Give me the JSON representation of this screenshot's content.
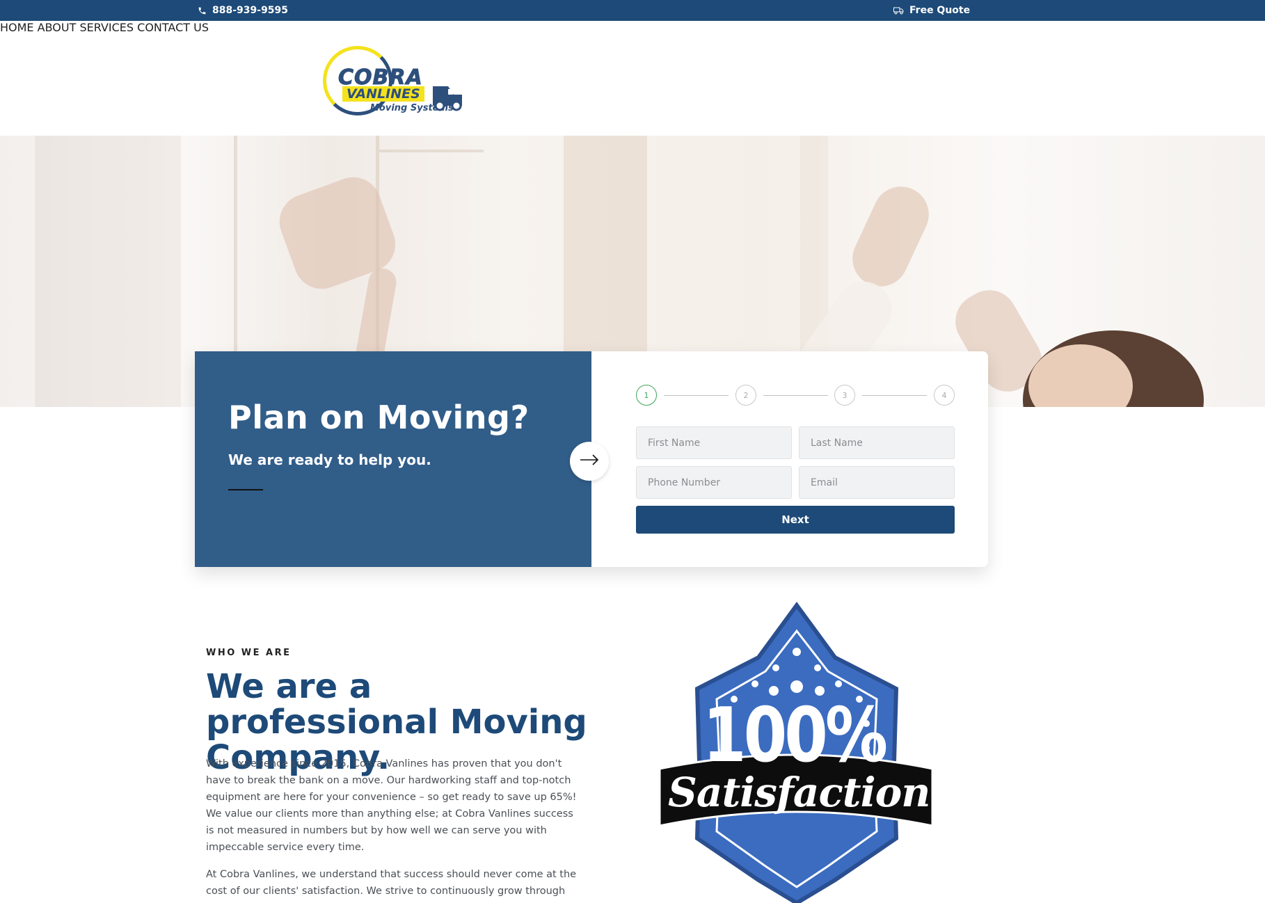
{
  "topbar": {
    "phone": "888-939-9595",
    "quote_label": "Free Quote"
  },
  "logo": {
    "line1": "COBRA",
    "line2": "VANLINES",
    "line3": "Moving Systems"
  },
  "nav": {
    "items": [
      "HOME",
      "ABOUT",
      "SERVICES",
      "CONTACT US"
    ]
  },
  "hero_card": {
    "title": "Plan on Moving?",
    "subtitle": "We are ready to help you.",
    "steps": [
      "1",
      "2",
      "3",
      "4"
    ],
    "active_step": 1,
    "fields": {
      "first_name_placeholder": "First Name",
      "last_name_placeholder": "Last Name",
      "phone_placeholder": "Phone Number",
      "email_placeholder": "Email"
    },
    "next_label": "Next"
  },
  "about": {
    "eyebrow": "WHO WE ARE",
    "headline": "We are a professional Moving Company.",
    "paragraph1": "With experience since 2015, Cobra Vanlines has proven that you don't have to break the bank on a move. Our hardworking staff and top-notch equipment are here for your convenience – so get ready to save up 65%! We value our clients more than anything else; at Cobra Vanlines success is not measured in numbers but by how well we can serve you with impeccable service every time.",
    "paragraph2": "At Cobra Vanlines, we understand that success should never come at the cost of our clients' satisfaction. We strive to continuously grow through"
  },
  "badge": {
    "percent": "100%",
    "word": "Satisfaction"
  },
  "colors": {
    "brand_navy": "#1d4a78",
    "card_blue": "#315d89",
    "logo_yellow": "#f4e21c",
    "step_green": "#3fa35b"
  }
}
